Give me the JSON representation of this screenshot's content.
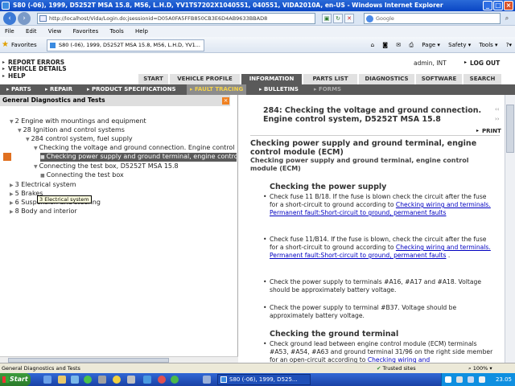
{
  "window": {
    "title": "S80 (-06), 1999, D5252T MSA 15.8, M56, L.H.D, YV1TS7202X1040551, 040551, VIDA2010A, en-US - Windows Internet Explorer"
  },
  "browser": {
    "url": "http://localhost/Vida/Login.do;jsessionid=D05A0FA5FFB850CB3E6D4AB9633BBAD8",
    "search_placeholder": "Google",
    "menu": [
      "File",
      "Edit",
      "View",
      "Favorites",
      "Tools",
      "Help"
    ],
    "favorites_label": "Favorites",
    "tab_title": "S80 (-06), 1999, D5252T MSA 15.8, M56, L.H.D, YV1...",
    "toolbar": [
      "Page ▾",
      "Safety ▾",
      "Tools ▾",
      "?▾"
    ]
  },
  "vida": {
    "top_links": [
      "REPORT ERRORS",
      "VEHICLE DETAILS",
      "HELP"
    ],
    "user": "admin, INT",
    "logout": "LOG OUT",
    "main_tabs": [
      "START",
      "VEHICLE PROFILE",
      "INFORMATION",
      "PARTS LIST",
      "DIAGNOSTICS",
      "SOFTWARE",
      "SEARCH"
    ],
    "active_tab": "INFORMATION",
    "sub_nav": [
      "PARTS",
      "REPAIR",
      "PRODUCT SPECIFICATIONS",
      "FAULT TRACING",
      "BULLETINS",
      "FORMS"
    ]
  },
  "left_panel": {
    "header": "General Diagnostics and Tests",
    "tree": [
      "2 Engine with mountings and equipment",
      "28 Ignition and control systems",
      "284 control system, fuel supply",
      "Checking the voltage and ground connection. Engine control",
      "Checking power supply and ground terminal, engine control",
      "Connecting the test box, D5252T MSA 15.8",
      "Connecting the test box",
      "3 Electrical system",
      "5 Brakes",
      "6 Suspension and steering",
      "8 Body and interior"
    ],
    "tooltip": "3 Electrical system"
  },
  "document": {
    "title": "284: Checking the voltage and ground connection. Engine control system, D5252T MSA 15.8",
    "print": "PRINT",
    "section_title": "Checking power supply and ground terminal, engine control module (ECM)",
    "section_subtitle": "Checking power supply and ground terminal, engine control module (ECM)",
    "power_heading": "Checking the power supply",
    "bullets": [
      {
        "text": "Check fuse 11 B/18. If the fuse is blown check the circuit after the fuse for a short-circuit to ground according to ",
        "link": "Checking wiring and terminals. Permanent fault:Short-circuit to ground, permanent faults"
      },
      {
        "text": "Check fuse 11/B14. If the fuse is blown, check the circuit after the fuse for a short-circuit to ground according to ",
        "link": "Checking wiring and terminals. Permanent fault:Short-circuit to ground, permanent faults",
        "after": " ."
      },
      {
        "text": "Check the power supply to terminals #A16, #A17 and #A18. Voltage should be approximately battery voltage."
      },
      {
        "text": "Check the power supply to terminal #B37. Voltage should be approximately battery voltage."
      }
    ],
    "ground_heading": "Checking the ground terminal",
    "ground_bullet": {
      "text": "Check ground lead between engine control module (ECM) terminals #A53, #A54, #A63 and ground terminal 31/96 on the right side member for an open-circuit according to ",
      "link": "Checking wiring and"
    }
  },
  "status_bar": {
    "text": "General Diagnostics and Tests",
    "zone": "Trusted sites",
    "zoom": "100%"
  },
  "taskbar": {
    "start": "Start",
    "task": "S80 (-06), 1999, D525...",
    "time": "23.05"
  },
  "colors": {
    "accent_orange": "#e07020",
    "nav_dark": "#5a5a5a"
  }
}
